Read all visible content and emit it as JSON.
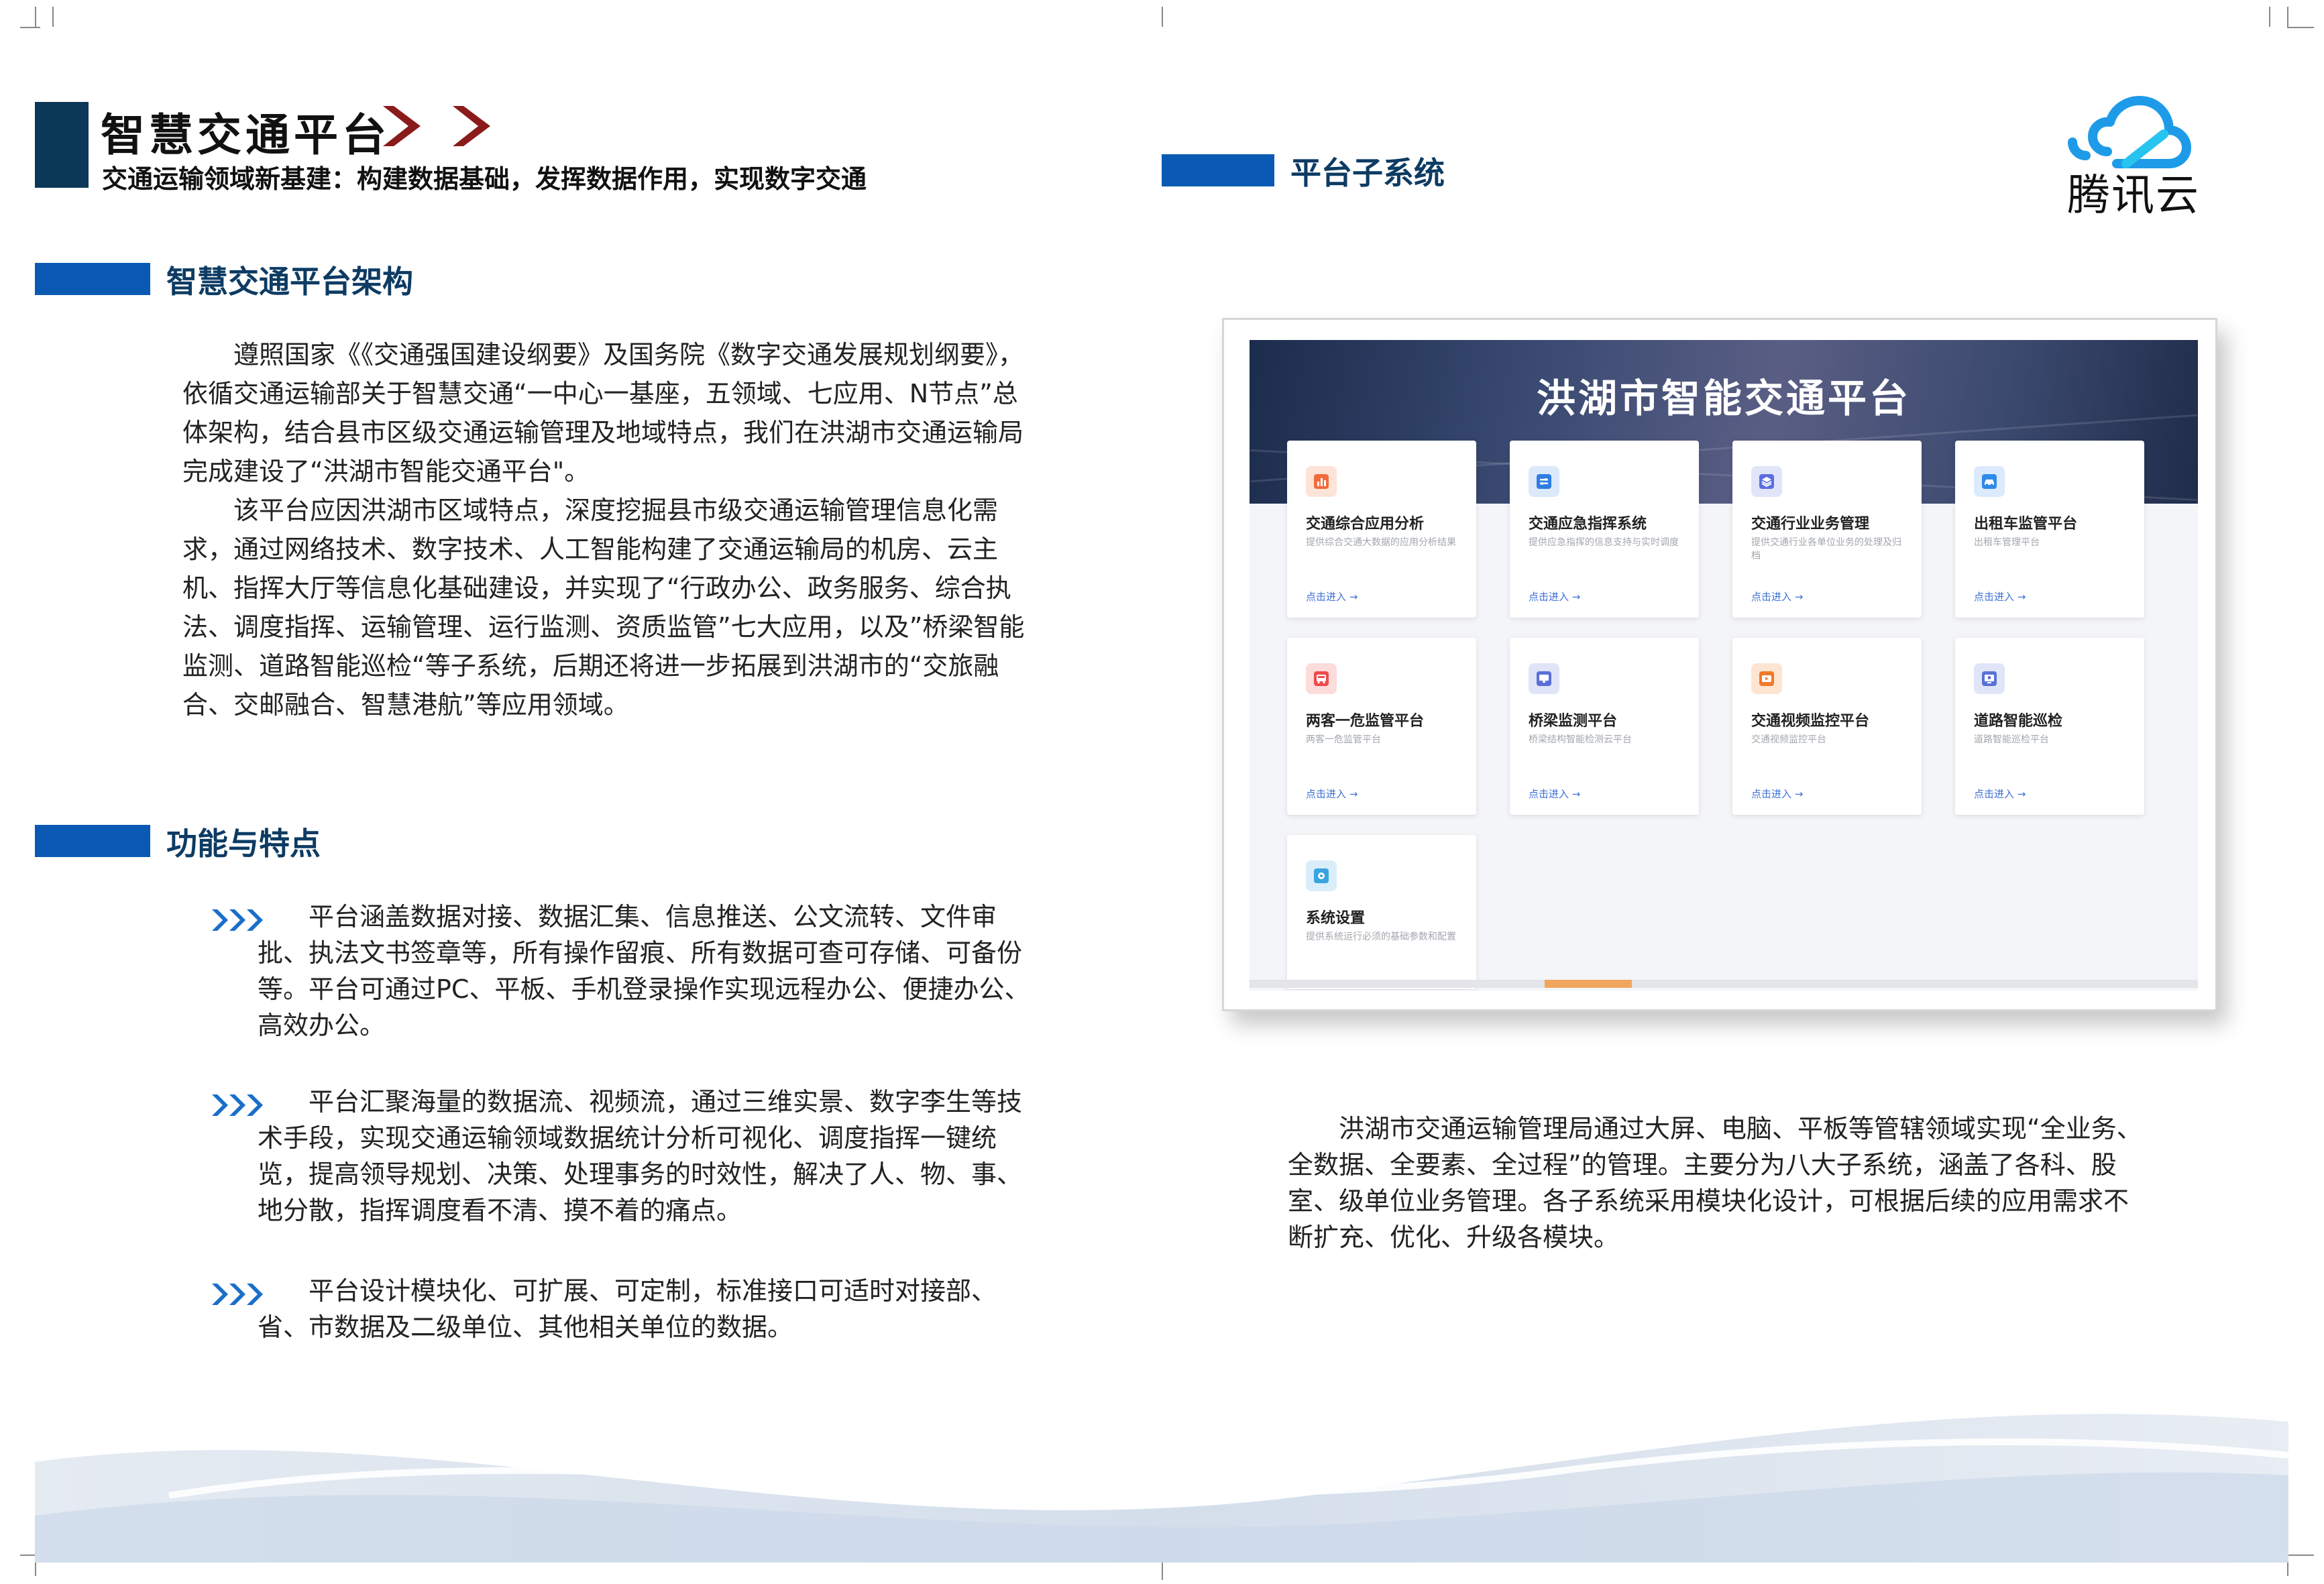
{
  "header": {
    "title": "智慧交通平台",
    "subtitle": "交通运输领域新基建：构建数据基础，发挥数据作用，实现数字交通"
  },
  "architecture": {
    "heading": "智慧交通平台架构",
    "paragraphs": [
      "遵照国家《《交通强国建设纲要》及国务院《数字交通发展规划纲要》，依循交通运输部关于智慧交通“一中心一基座，五领域、七应用、N节点”总体架构，结合县市区级交通运输管理及地域特点，我们在洪湖市交通运输局完成建设了“洪湖市智能交通平台\"。",
      "该平台应因洪湖市区域特点，深度挖掘县市级交通运输管理信息化需求，通过网络技术、数字技术、人工智能构建了交通运输局的机房、云主机、指挥大厅等信息化基础建设，并实现了“行政办公、政务服务、综合执法、调度指挥、运输管理、运行监测、资质监管”七大应用，以及”桥梁智能监测、道路智能巡检“等子系统，后期还将进一步拓展到洪湖市的“交旅融合、交邮融合、智慧港航”等应用领域。"
    ]
  },
  "features": {
    "heading": "功能与特点",
    "bullet_icon": "triple-chevron-right-icon",
    "items": [
      "平台涵盖数据对接、数据汇集、信息推送、公文流转、文件审批、执法文书签章等，所有操作留痕、所有数据可查可存储、可备份等。平台可通过PC、平板、手机登录操作实现远程办公、便捷办公、高效办公。",
      "平台汇聚海量的数据流、视频流，通过三维实景、数字李生等技术手段，实现交通运输领域数据统计分析可视化、调度指挥一键统览，提高领导规划、决策、处理事务的时效性，解决了人、物、事、地分散，指挥调度看不清、摸不着的痛点。",
      "平台设计模块化、可扩展、可定制，标准接口可适时对接部、省、市数据及二级单位、其他相关单位的数据。"
    ]
  },
  "subsystems": {
    "heading": "平台子系统",
    "logo_text": "腾讯云",
    "screenshot": {
      "banner_title": "洪湖市智能交通平台",
      "link_text": "点击进入 →",
      "cards": [
        {
          "title": "交通综合应用分析",
          "desc": "提供综合交通大数据的应用分析结果",
          "icon": "bar-chart-icon",
          "color": "#f26b3a"
        },
        {
          "title": "交通应急指挥系统",
          "desc": "提供应急指挥的信息支持与实时调度",
          "icon": "command-icon",
          "color": "#2f7de1"
        },
        {
          "title": "交通行业业务管理",
          "desc": "提供交通行业各单位业务的处理及归档",
          "icon": "layers-icon",
          "color": "#5b6ee1"
        },
        {
          "title": "出租车监管平台",
          "desc": "出租车管理平台",
          "icon": "car-icon",
          "color": "#2f8ae8"
        },
        {
          "title": "两客一危监管平台",
          "desc": "两客一危监管平台",
          "icon": "bus-icon",
          "color": "#ef4b4b"
        },
        {
          "title": "桥梁监测平台",
          "desc": "桥梁结构智能检测云平台",
          "icon": "monitor-icon",
          "color": "#5a6fd8"
        },
        {
          "title": "交通视频监控平台",
          "desc": "交通视频监控平台",
          "icon": "video-icon",
          "color": "#f07a2c"
        },
        {
          "title": "道路智能巡检",
          "desc": "道路智能巡检平台",
          "icon": "location-icon",
          "color": "#5a72d6"
        },
        {
          "title": "系统设置",
          "desc": "提供系统运行必须的基础参数和配置",
          "icon": "gear-icon",
          "color": "#3aa4e0"
        }
      ]
    },
    "paragraph": "洪湖市交通运输管理局通过大屏、电脑、平板等管辖领域实现“全业务、全数据、全要素、全过程”的管理。主要分为八大子系统，涵盖了各科、股室、级单位业务管理。各子系统采用模块化设计，可根据后续的应用需求不断扩充、优化、升级各模块。"
  },
  "colors": {
    "heading_bar": "#0a5ab3",
    "heading_text": "#0d3b63",
    "title_block": "#0c3857",
    "chevron": "#8b1a1a",
    "bullet": "#1a6fc9"
  }
}
